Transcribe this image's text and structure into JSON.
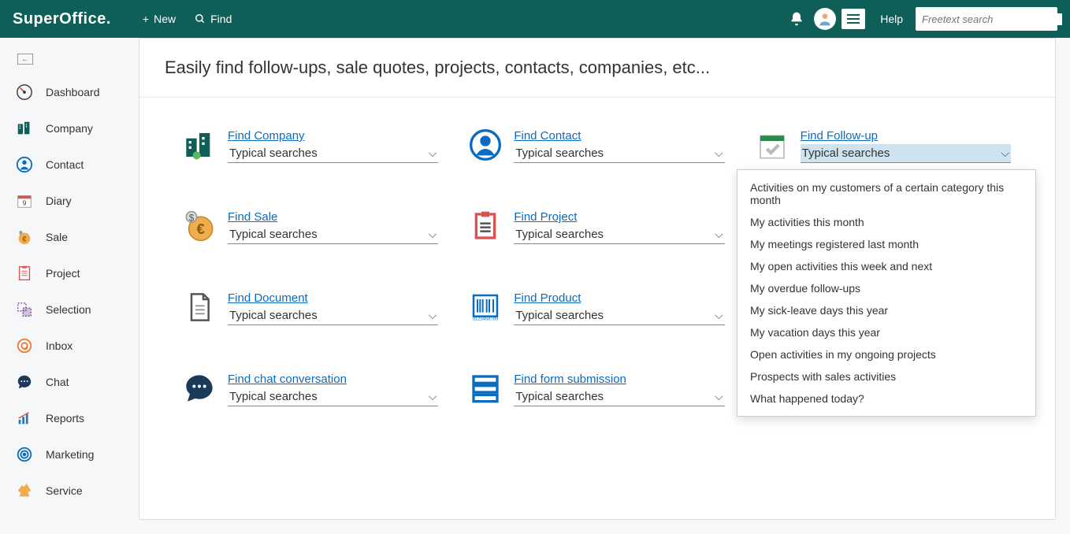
{
  "app_name": "SuperOffice.",
  "topbar": {
    "new": "New",
    "find": "Find",
    "help": "Help",
    "search_placeholder": "Freetext search"
  },
  "sidebar": {
    "items": [
      {
        "label": "Dashboard",
        "icon": "dashboard"
      },
      {
        "label": "Company",
        "icon": "company"
      },
      {
        "label": "Contact",
        "icon": "contact"
      },
      {
        "label": "Diary",
        "icon": "diary"
      },
      {
        "label": "Sale",
        "icon": "sale"
      },
      {
        "label": "Project",
        "icon": "project"
      },
      {
        "label": "Selection",
        "icon": "selection"
      },
      {
        "label": "Inbox",
        "icon": "inbox"
      },
      {
        "label": "Chat",
        "icon": "chat"
      },
      {
        "label": "Reports",
        "icon": "reports"
      },
      {
        "label": "Marketing",
        "icon": "marketing"
      },
      {
        "label": "Service",
        "icon": "service"
      }
    ]
  },
  "main": {
    "heading": "Easily find follow-ups, sale quotes, projects, contacts, companies, etc...",
    "typical_label": "Typical searches",
    "cards": [
      {
        "title": "Find Company"
      },
      {
        "title": "Find Contact"
      },
      {
        "title": "Find Follow-up",
        "open": true
      },
      {
        "title": "Find Sale"
      },
      {
        "title": "Find Project"
      },
      {
        "title": "Find Document"
      },
      {
        "title": "Find Product"
      },
      {
        "title": "Find chat conversation"
      },
      {
        "title": "Find form submission"
      }
    ],
    "hidden_card": {
      "title": "",
      "select": "Typical searches"
    },
    "dropdown": [
      "Activities on my customers of a certain category this month",
      "My activities this month",
      "My meetings registered last month",
      "My open activities this week and next",
      "My overdue follow-ups",
      "My sick-leave days this year",
      "My vacation days this year",
      "Open activities in my ongoing projects",
      "Prospects with sales activities",
      "What happened today?"
    ]
  }
}
